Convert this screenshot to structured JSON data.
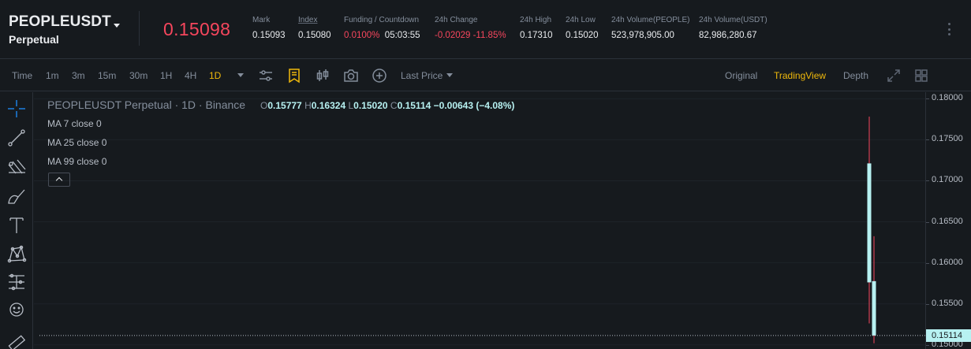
{
  "header": {
    "symbol": "PEOPLEUSDT",
    "contract_type": "Perpetual",
    "last_price": "0.15098",
    "stats": [
      {
        "label": "Mark",
        "value": "0.15093"
      },
      {
        "label": "Index",
        "value": "0.15080"
      },
      {
        "label": "Funding / Countdown",
        "value_a": "0.0100%",
        "value_b": "05:03:55"
      },
      {
        "label": "24h Change",
        "value": "-0.02029 -11.85%"
      },
      {
        "label": "24h High",
        "value": "0.17310"
      },
      {
        "label": "24h Low",
        "value": "0.15020"
      },
      {
        "label": "24h Volume(PEOPLE)",
        "value": "523,978,905.00"
      },
      {
        "label": "24h Volume(USDT)",
        "value": "82,986,280.67"
      }
    ]
  },
  "toolbar": {
    "intervals": [
      "Time",
      "1m",
      "3m",
      "15m",
      "30m",
      "1H",
      "4H",
      "1D"
    ],
    "active_interval": "1D",
    "price_type": "Last Price",
    "views": [
      "Original",
      "TradingView",
      "Depth"
    ],
    "active_view": "TradingView",
    "icons": [
      "indicator-settings-icon",
      "bookmark-icon",
      "candlestick-type-icon",
      "camera-icon",
      "add-icon",
      "expand-icon",
      "grid-layout-icon"
    ]
  },
  "draw_tools": [
    "crosshair-icon",
    "trend-line-icon",
    "pitchfork-icon",
    "brush-icon",
    "text-icon",
    "pattern-icon",
    "measure-icon",
    "emoji-icon",
    "ruler-icon"
  ],
  "chart": {
    "title": "PEOPLEUSDT Perpetual · 1D · Binance",
    "ohlc": {
      "o_key": "O",
      "o": "0.15777",
      "h_key": "H",
      "h": "0.16324",
      "l_key": "L",
      "l": "0.15020",
      "c_key": "C",
      "c": "0.15114",
      "change": "−0.00643 (−4.08%)"
    },
    "ma": [
      "MA 7 close 0",
      "MA 25 close 0",
      "MA 99 close 0"
    ],
    "axis_ticks": [
      "0.18000",
      "0.17500",
      "0.17000",
      "0.16500",
      "0.16000",
      "0.15500",
      "0.15000"
    ],
    "current_price_tag": "0.15114",
    "colors": {
      "up": "#b7f1f1",
      "down": "#f6465d",
      "accent": "#f0b90b"
    }
  },
  "chart_data": {
    "type": "candlestick",
    "ylim": [
      0.1495,
      0.1808
    ],
    "candles": [
      {
        "open": 0.17212,
        "high": 0.17782,
        "low": 0.15262,
        "close": 0.15762
      },
      {
        "open": 0.15777,
        "high": 0.16324,
        "low": 0.1502,
        "close": 0.15114
      }
    ]
  }
}
